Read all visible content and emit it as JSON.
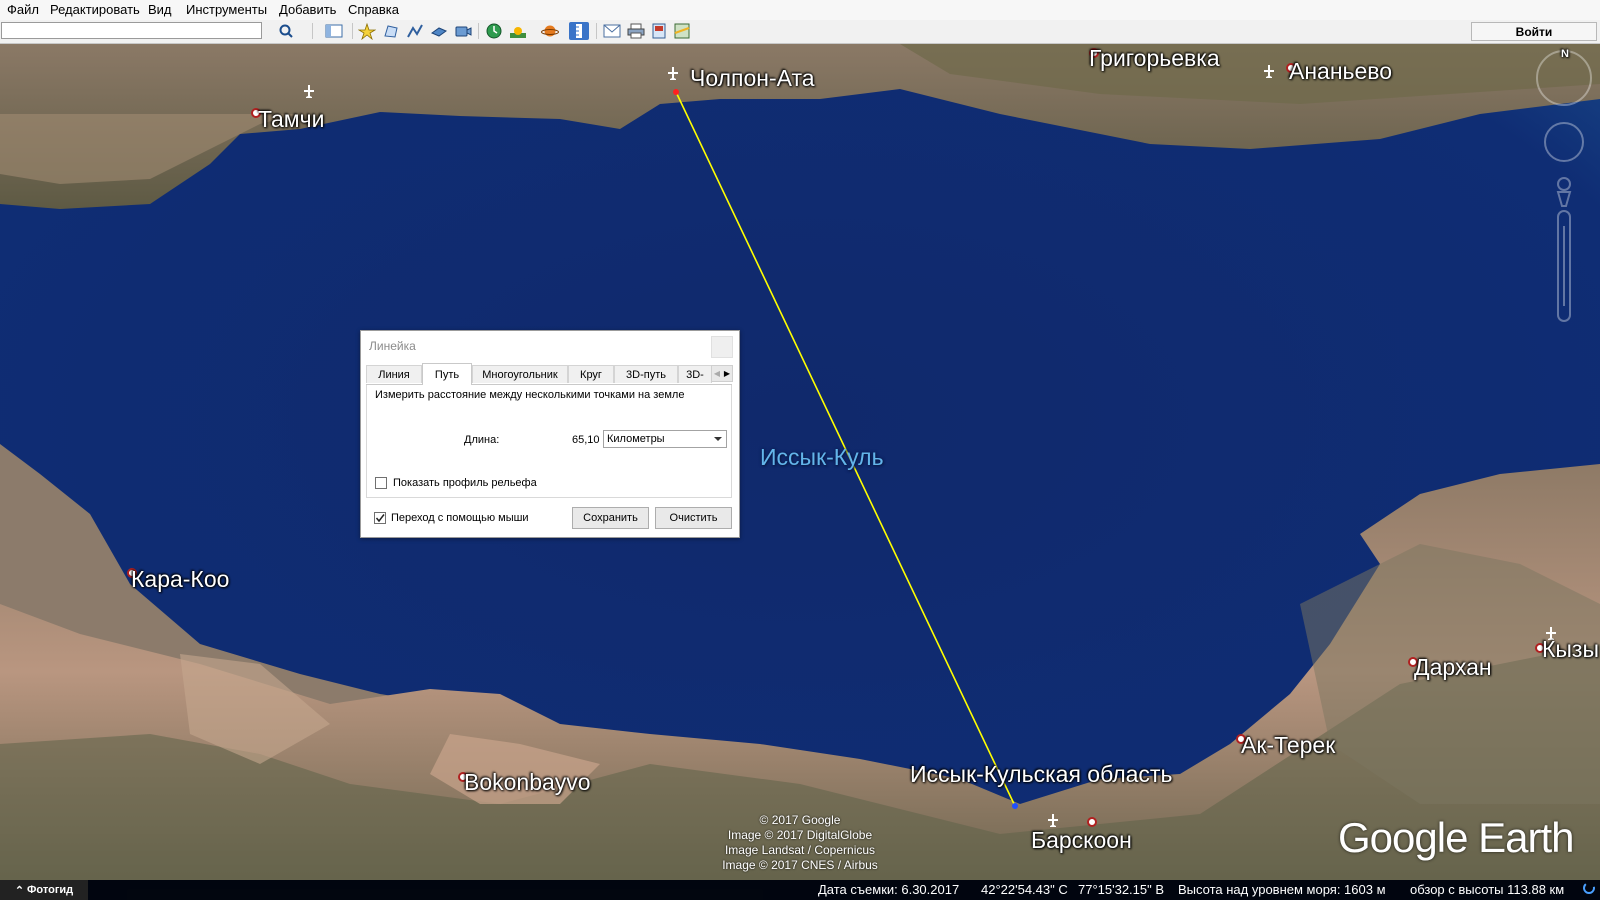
{
  "menu": [
    "Файл",
    "Редактировать",
    "Вид",
    "Инструменты",
    "Добавить",
    "Справка"
  ],
  "toolbar": {
    "search_value": "",
    "signin_label": "Войти",
    "icons": [
      "search-icon",
      "sidebar-icon",
      "placemark-icon",
      "polygon-icon",
      "path-icon",
      "image-overlay-icon",
      "record-tour-icon",
      "historical-imagery-icon",
      "sunlight-icon",
      "planets-icon",
      "ruler-icon",
      "email-icon",
      "print-icon",
      "save-image-icon",
      "maps-icon"
    ]
  },
  "map": {
    "labels": {
      "cholpon_ata": "Чолпон-Ата",
      "grigorievka": "Григорьевка",
      "ananievo": "Ананьево",
      "tamchi": "Тамчи",
      "lake": "Иссык-Куль",
      "kara_koo": "Кара-Коо",
      "darkhan": "Дархан",
      "kyzyl": "Кызы",
      "ak_terek": "Ак-Терек",
      "bokonbayvo": "Bokonbayvo",
      "region": "Иссык-Кульская область",
      "barskoon": "Барскоон"
    },
    "credits": [
      "© 2017 Google",
      "Image © 2017 DigitalGlobe",
      "Image Landsat / Copernicus",
      "Image © 2017 CNES / Airbus"
    ],
    "logo": "Google Earth",
    "compass_letter": "N",
    "colors": {
      "measure_line": "#ffff00",
      "lake": "#0f2a6e",
      "lake_label": "#63b5ea"
    }
  },
  "status": {
    "photo_tour": "Фотогид",
    "date": "Дата съемки: 6.30.2017",
    "lat": "42°22'54.43\" С",
    "lon": "77°15'32.15\" В",
    "elevation": "Высота над уровнем моря:  1603 м",
    "eye": "обзор с высоты 113.88 км"
  },
  "ruler": {
    "title": "Линейка",
    "tabs": [
      "Линия",
      "Путь",
      "Многоугольник",
      "Круг",
      "3D-путь",
      "3D-"
    ],
    "active_tab": "Путь",
    "description": "Измерить расстояние между несколькими точками на земле",
    "length_label": "Длина:",
    "length_value": "65,10",
    "unit": "Километры",
    "show_profile_label": "Показать профиль рельефа",
    "show_profile_checked": false,
    "mouse_nav_label": "Переход с помощью мыши",
    "mouse_nav_checked": true,
    "save_label": "Сохранить",
    "clear_label": "Очистить"
  }
}
